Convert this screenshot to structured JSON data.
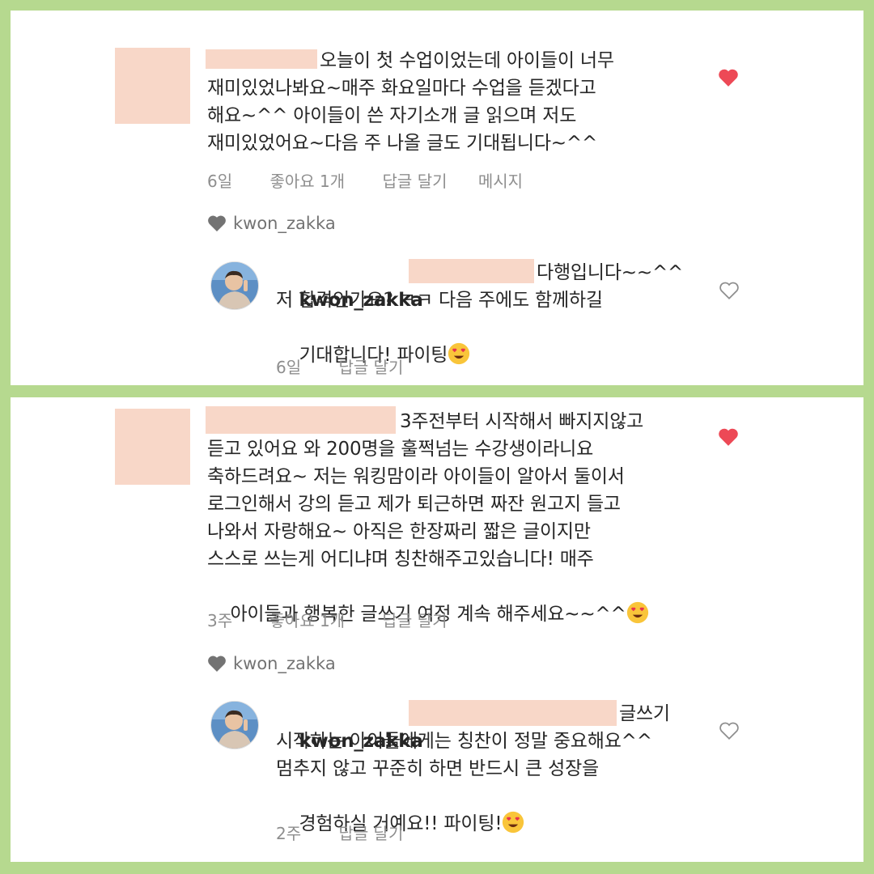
{
  "comments": [
    {
      "text_lines": [
        "오늘이 첫 수업이었는데 아이들이 너무",
        "재미있었나봐요~매주 화요일마다 수업을 듣겠다고",
        "해요~^^ 아이들이 쓴 자기소개 글 읽으며 저도",
        "재미있었어요~다음 주 나올 글도 기대됩니다~^^"
      ],
      "time": "6일",
      "likes": "좋아요 1개",
      "reply_action": "답글 달기",
      "message_action": "메시지",
      "liked_by": "kwon_zakka",
      "reply": {
        "username": "kwon_zakka",
        "text_lines": [
          "다행입니다~~^^",
          "저 합격인가요? ㅋㅋ 다음 주에도 함께하길",
          "기대합니다! 파이팅"
        ],
        "time": "6일",
        "reply_action": "답글 달기",
        "emoji": "smiling-face-with-heart-eyes"
      }
    },
    {
      "text_lines": [
        "3주전부터 시작해서 빠지지않고",
        "듣고 있어요 와 200명을 훌쩍넘는 수강생이라니요",
        "축하드려요~ 저는 워킹맘이라 아이들이 알아서 둘이서",
        "로그인해서 강의 듣고 제가 퇴근하면 짜잔 원고지 들고",
        "나와서 자랑해요~ 아직은 한장짜리 짧은 글이지만",
        "스스로 쓰는게 어디냐며 칭찬해주고있습니다! 매주",
        "아이들과 행복한 글쓰기 여정 계속 해주세요~~^^"
      ],
      "time": "3주",
      "likes": "좋아요 1개",
      "reply_action": "답글 달기",
      "liked_by": "kwon_zakka",
      "emoji": "smiling-face-with-heart-eyes",
      "reply": {
        "username": "kwon_zakka",
        "text_lines": [
          "글쓰기",
          "시작하는 아이들에게는 칭찬이 정말 중요해요^^",
          "멈추지 않고 꾸준히 하면 반드시 큰 성장을",
          "경험하실 거예요!! 파이팅!"
        ],
        "time": "2주",
        "reply_action": "답글 달기",
        "emoji": "smiling-face-with-heart-eyes"
      }
    }
  ],
  "colors": {
    "background": "#b6d98f",
    "redaction": "#f8d7c8",
    "heart_red": "#ed4956",
    "meta_gray": "#8e8e8e"
  }
}
